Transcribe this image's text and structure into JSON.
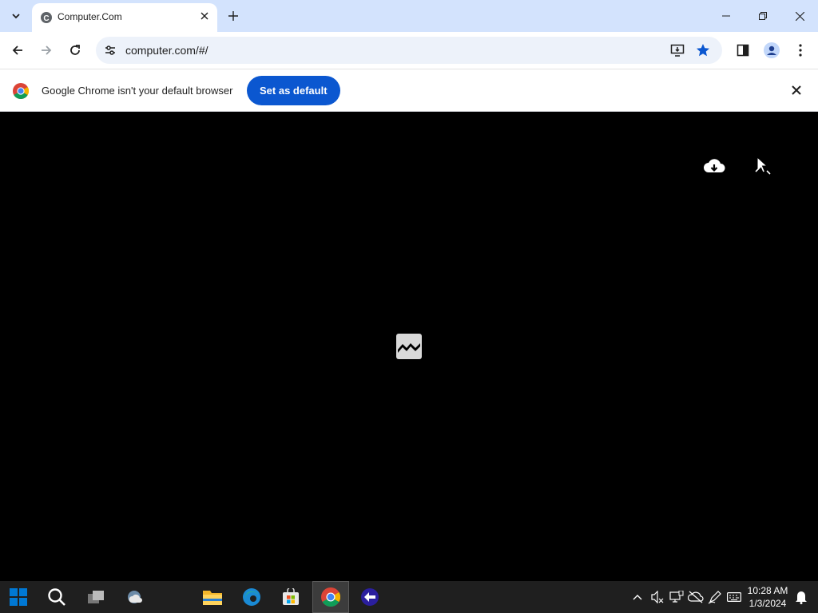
{
  "browser": {
    "tab": {
      "title": "Computer.Com"
    },
    "address_bar": {
      "url": "computer.com/#/"
    }
  },
  "infobar": {
    "message": "Google Chrome isn't your default browser",
    "button_label": "Set as default"
  },
  "taskbar": {
    "clock": {
      "time": "10:28 AM",
      "date": "1/3/2024"
    }
  },
  "colors": {
    "tabstrip": "#d3e3fd",
    "omnibox": "#edf2fa",
    "accent": "#0b57d0",
    "content_bg": "#000000",
    "taskbar": "#1f1f1f"
  },
  "icons": [
    "tab-search-icon",
    "favicon-icon",
    "close-tab-icon",
    "new-tab-icon",
    "minimize-icon",
    "restore-icon",
    "close-window-icon",
    "back-icon",
    "forward-icon",
    "reload-icon",
    "site-info-icon",
    "install-app-icon",
    "bookmark-star-icon",
    "side-panel-icon",
    "profile-icon",
    "menu-icon",
    "chrome-logo-icon",
    "close-infobar-icon",
    "cloud-download-icon",
    "cursor-tool-icon",
    "broken-image-icon",
    "start-icon",
    "search-icon",
    "task-view-icon",
    "weather-icon",
    "file-explorer-icon",
    "edge-icon",
    "store-icon",
    "chrome-icon",
    "app-icon",
    "chevron-up-icon",
    "sound-icon",
    "network-icon",
    "onedrive-icon",
    "pen-icon",
    "keyboard-icon",
    "notification-icon"
  ]
}
